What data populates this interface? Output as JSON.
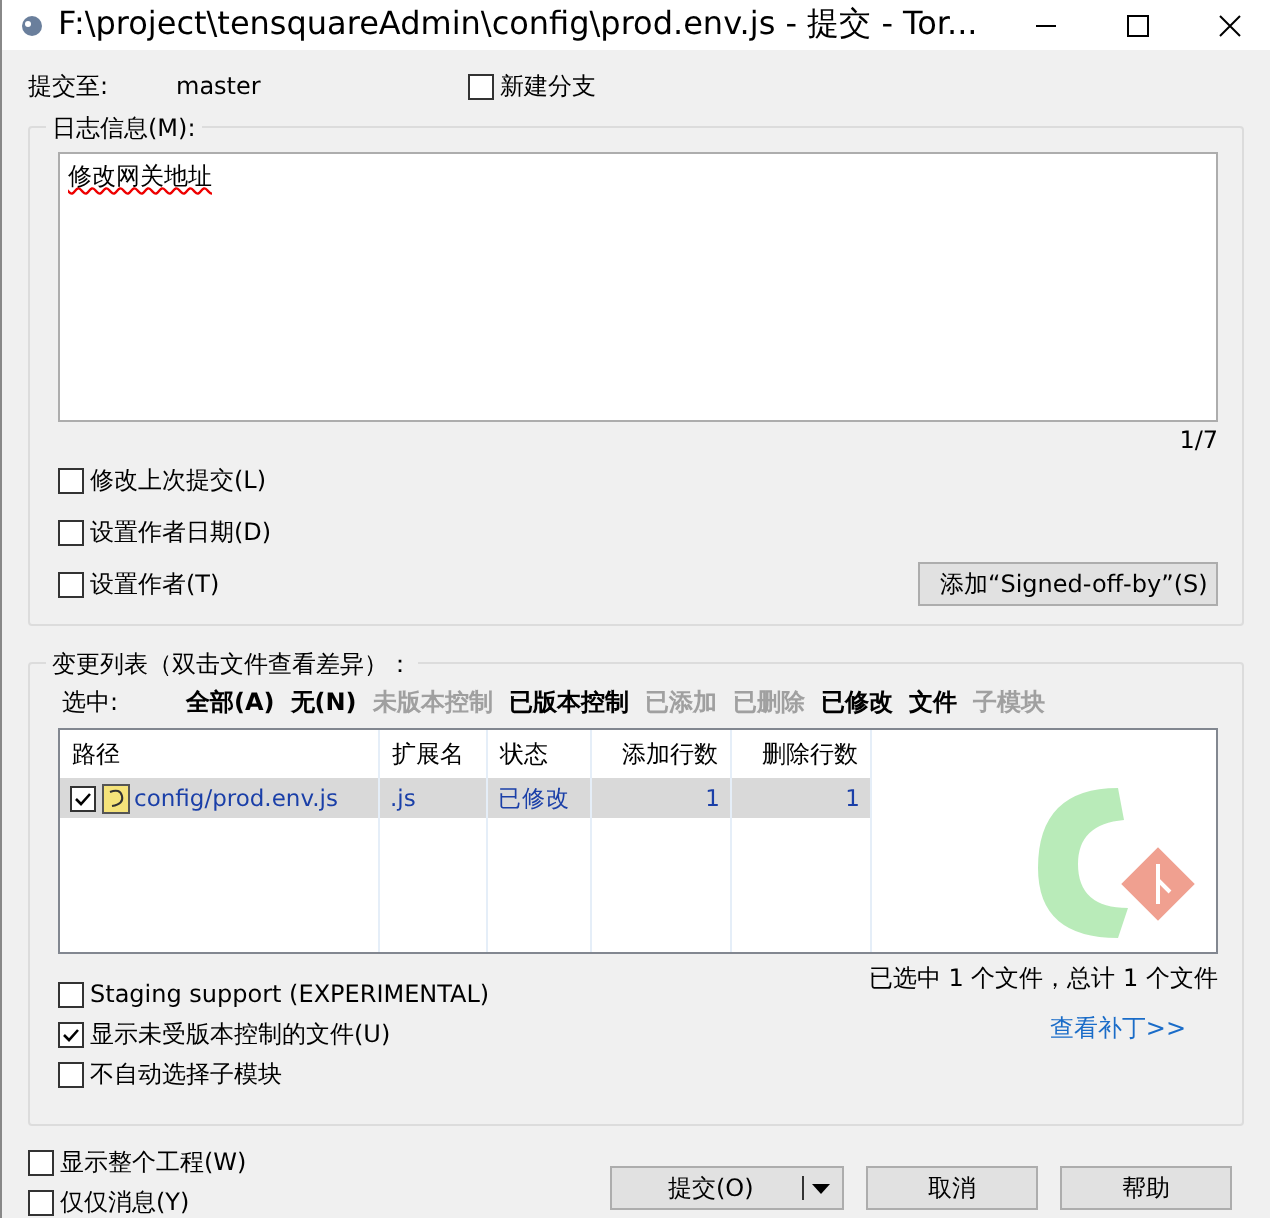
{
  "window": {
    "title": "F:\\project\\tensquareAdmin\\config\\prod.env.js - 提交 - Tor..."
  },
  "commit_to": {
    "label": "提交至:",
    "branch": "master"
  },
  "new_branch": {
    "label": "新建分支",
    "checked": false
  },
  "log_group": {
    "title": "日志信息(M):",
    "message": "修改网关地址",
    "counter": "1/7",
    "options": [
      {
        "label": "修改上次提交(L)",
        "checked": false
      },
      {
        "label": "设置作者日期(D)",
        "checked": false
      },
      {
        "label": "设置作者(T)",
        "checked": false
      }
    ],
    "signed_off_button": "添加“Signed-off-by”(S)"
  },
  "changes_group": {
    "title": "变更列表（双击文件查看差异）：",
    "select_label": "选中:",
    "filters": [
      {
        "label": "全部(A)",
        "enabled": true
      },
      {
        "label": "无(N)",
        "enabled": true
      },
      {
        "label": "未版本控制",
        "enabled": false
      },
      {
        "label": "已版本控制",
        "enabled": true
      },
      {
        "label": "已添加",
        "enabled": false
      },
      {
        "label": "已删除",
        "enabled": false
      },
      {
        "label": "已修改",
        "enabled": true
      },
      {
        "label": "文件",
        "enabled": true
      },
      {
        "label": "子模块",
        "enabled": false
      }
    ],
    "table": {
      "columns": [
        "路径",
        "扩展名",
        "状态",
        "添加行数",
        "删除行数"
      ],
      "rows": [
        {
          "checked": true,
          "selected": true,
          "cells": [
            "config/prod.env.js",
            ".js",
            "已修改",
            "1",
            "1"
          ]
        }
      ]
    },
    "summary": "已选中 1 个文件，总计 1 个文件",
    "view_patch_link": "查看补丁>>",
    "options": [
      {
        "label": "Staging support (EXPERIMENTAL)",
        "checked": false
      },
      {
        "label": "显示未受版本控制的文件(U)",
        "checked": true
      },
      {
        "label": "不自动选择子模块",
        "checked": false
      }
    ]
  },
  "bottom_options": [
    {
      "label": "显示整个工程(W)",
      "checked": false
    },
    {
      "label": "仅仅消息(Y)",
      "checked": false
    }
  ],
  "buttons": {
    "commit": "提交(O)",
    "cancel": "取消",
    "help": "帮助"
  }
}
